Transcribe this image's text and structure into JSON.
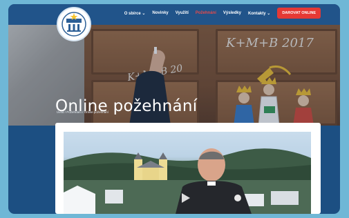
{
  "nav": {
    "items": [
      {
        "label": "O sbírce",
        "dropdown": true
      },
      {
        "label": "Novinky",
        "dropdown": false
      },
      {
        "label": "Využití",
        "dropdown": false
      },
      {
        "label": "Požehnání",
        "dropdown": false,
        "active": true
      },
      {
        "label": "Výsledky",
        "dropdown": false
      },
      {
        "label": "Kontakty",
        "dropdown": true
      }
    ],
    "donate_label": "DAROVAT ONLINE"
  },
  "hero": {
    "title": "Online požehnání",
    "chalk_top": "K+M+B 2017",
    "chalk_left": "K+M+B 20",
    "breadcrumb": [
      "Úvod",
      "Požehnání",
      "Online požehnání"
    ]
  },
  "colors": {
    "frame_bg": "#1c4f82",
    "header_bg": "#21548a",
    "active_nav": "#e84a4a",
    "donate_bg": "#e53935",
    "page_bg": "#6fb7d6"
  }
}
